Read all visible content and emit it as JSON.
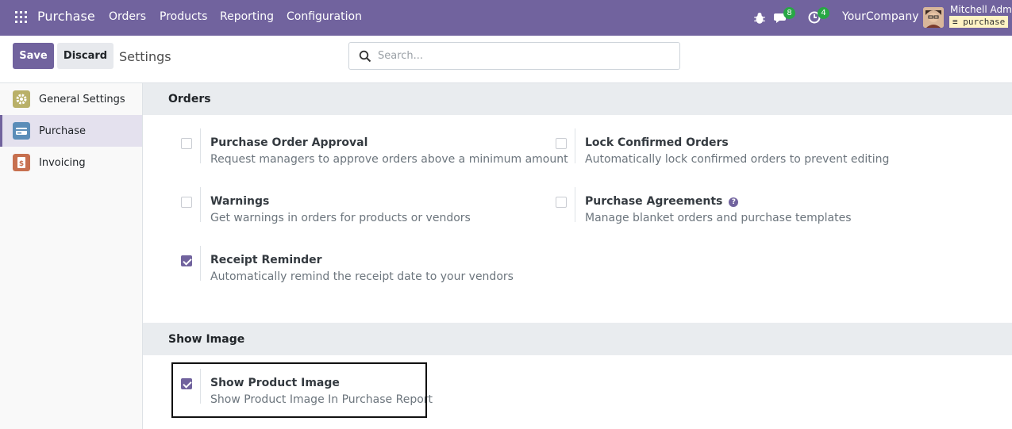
{
  "navbar": {
    "brand": "Purchase",
    "menu": [
      "Orders",
      "Products",
      "Reporting",
      "Configuration"
    ],
    "messages_count": "8",
    "activities_count": "4",
    "company": "YourCompany",
    "user_name": "Mitchell Admin",
    "database": "purchase",
    "color": "#71639e"
  },
  "controls": {
    "save_label": "Save",
    "discard_label": "Discard",
    "title": "Settings",
    "search_placeholder": "Search..."
  },
  "sidebar": {
    "items": [
      {
        "label": "General Settings",
        "icon": "gear-icon"
      },
      {
        "label": "Purchase",
        "icon": "purchase-app-icon"
      },
      {
        "label": "Invoicing",
        "icon": "invoicing-app-icon"
      }
    ],
    "active": "Purchase"
  },
  "orders": {
    "title": "Orders",
    "settings": [
      {
        "title": "Purchase Order Approval",
        "desc": "Request managers to approve orders above a minimum amount",
        "checked": false
      },
      {
        "title": "Lock Confirmed Orders",
        "desc": "Automatically lock confirmed orders to prevent editing",
        "checked": false
      },
      {
        "title": "Warnings",
        "desc": "Get warnings in orders for products or vendors",
        "checked": false
      },
      {
        "title": "Purchase Agreements",
        "desc": "Manage blanket orders and purchase templates",
        "checked": false
      },
      {
        "title": "Receipt Reminder",
        "desc": "Automatically remind the receipt date to your vendors",
        "checked": true
      }
    ]
  },
  "show_image": {
    "title": "Show Image",
    "settings": [
      {
        "title": "Show Product Image",
        "desc": "Show Product Image In Purchase Report",
        "checked": true
      }
    ]
  }
}
